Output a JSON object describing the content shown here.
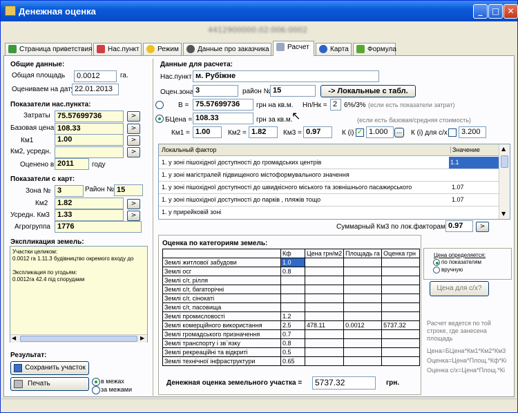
{
  "window": {
    "title": "Денежная оценка",
    "subtitle": "4412900000:02:006:0002"
  },
  "tabs": [
    "Страница приветствия",
    "Нас.пункт",
    "Режим",
    "Данные про заказчика",
    "Расчет",
    "Карта",
    "Формула"
  ],
  "left": {
    "general_header": "Общие данные:",
    "area_label": "Общая площадь",
    "area_value": "0.0012",
    "area_unit": "га.",
    "date_label": "Оцениваем на дату",
    "date_value": "22.01.2013",
    "settlement_header": "Показатели нас.пункта:",
    "costs_label": "Затраты",
    "costs_value": "75.57699736",
    "base_price_label": "Базовая цена",
    "base_price_value": "108.33",
    "km1_label": "Км1",
    "km1_value": "1.00",
    "km2avg_label": "Км2, усредн.",
    "km2avg_value": "",
    "valued_in_label": "Оценено в",
    "valued_in_value": "2011",
    "valued_in_unit": "году",
    "map_header": "Показатели с карт:",
    "zone_label": "Зона №",
    "zone_value": "3",
    "district_label": "Район №",
    "district_value": "15",
    "km2_label": "Км2",
    "km2_value": "1.82",
    "km3avg_label": "Усредн. Км3",
    "km3avg_value": "1.33",
    "agrogroup_label": "Агрогруппа",
    "agrogroup_value": "1776",
    "explication_header": "Экспликация земель:",
    "memo_lines": [
      "Участки целиком:",
      "0.0012 га   1.11.3 будівництво окремого входу до",
      "",
      "Экспликация по угодьям:",
      "0.0012га    42.4 під спорудами"
    ],
    "result_header": "Результат:",
    "save_button": "Сохранить участок",
    "print_button": "Печать",
    "radio_within": "в межах",
    "radio_outside": "за межами"
  },
  "right": {
    "calc_header": "Данные для расчета:",
    "settlement_label": "Нас.пункт",
    "settlement_value": "м. Рубіжне",
    "zone_label": "Оцен.зона",
    "zone_value": "3",
    "district_label": "район №",
    "district_value": "15",
    "local_button": "-> Локальные с табл.",
    "b_label": "В =",
    "b_value": "75.57699736",
    "b_unit": "грн на кв.м.",
    "nn_label": "Нп/Нк =",
    "nn_value": "2",
    "nn_unit": "6%/3%",
    "nn_hint": "(если есть показатели затрат)",
    "bprice_label": "БЦена =",
    "bprice_value": "108.33",
    "bprice_unit": "грн за кв.м.",
    "bprice_hint": "(если есть базовая/средняя стоимость)",
    "km1_label": "Км1 =",
    "km1_value": "1.00",
    "km2_label": "Км2 =",
    "km2_value": "1.82",
    "km3_label": "Км3 =",
    "km3_value": "0.97",
    "ki_label": "К (і)",
    "ki_value": "1.000",
    "ki_btn": "...",
    "kis_label": "К (і) для с/х",
    "kis_value": "3.200",
    "factor_col": "Локальный фактор",
    "value_col": "Значение",
    "factors": [
      {
        "name": "1. у зоні пішохідної доступності до громадських центрів",
        "value": "1.1"
      },
      {
        "name": "1. у зоні магістралей підвищеного містоформувального значення",
        "value": ""
      },
      {
        "name": "1. у зоні пішохідної доступності до швидкісного міського та зовнішнього пасажирського",
        "value": "1.07"
      },
      {
        "name": "1. у зоні пішохідної доступності до парків , пляжів тощо",
        "value": "1.07"
      },
      {
        "name": "1. у прирейковій зоні",
        "value": ""
      }
    ],
    "total_km3_label": "Суммарный Км3 по лок.факторам=",
    "total_km3_value": "0.97",
    "categories_header": "Оценка по категориям земель:",
    "cat_cols": [
      "",
      "Кф",
      "Цена грн/м2",
      "Площадь га",
      "Оценка грн"
    ],
    "categories": [
      {
        "name": "Землі житлової забудови",
        "kf": "1.0",
        "price": "",
        "area": "",
        "value": ""
      },
      {
        "name": "Землі осг",
        "kf": "0.8",
        "price": "",
        "area": "",
        "value": ""
      },
      {
        "name": "Землі с/г, рілля",
        "kf": "",
        "price": "",
        "area": "",
        "value": ""
      },
      {
        "name": "Землі с/г, багаторічні",
        "kf": "",
        "price": "",
        "area": "",
        "value": ""
      },
      {
        "name": "Землі с/г, сінокаті",
        "kf": "",
        "price": "",
        "area": "",
        "value": ""
      },
      {
        "name": "Землі с/г, пасовища",
        "kf": "",
        "price": "",
        "area": "",
        "value": ""
      },
      {
        "name": "Землі промисловості",
        "kf": "1.2",
        "price": "",
        "area": "",
        "value": ""
      },
      {
        "name": "Землі комерційного використання",
        "kf": "2.5",
        "price": "478.11",
        "area": "0.0012",
        "value": "5737.32"
      },
      {
        "name": "Землі громадського призначення",
        "kf": "0.7",
        "price": "",
        "area": "",
        "value": ""
      },
      {
        "name": "Землі транспорту і зв`язку",
        "kf": "0.8",
        "price": "",
        "area": "",
        "value": ""
      },
      {
        "name": "Землі рекреаційні та відкриті",
        "kf": "0.5",
        "price": "",
        "area": "",
        "value": ""
      },
      {
        "name": "Землі технічної інфраструктури",
        "kf": "0.65",
        "price": "",
        "area": "",
        "value": ""
      }
    ],
    "price_group_title": "Цена определяется:",
    "radio_indicators": "по показателям",
    "radio_manual": "вручную",
    "price_ag_button": "Цена для с/х?",
    "note": "Расчет ведется по той строке, где занесена площадь",
    "formula1": "Цена=БЦена*Км1*Км2*Км3",
    "formula2": "Оценка=Цена*Площ.*Кф*Кі",
    "formula3": "Оценка с/х=Цена*Площ.*Кі",
    "total_label": "Денежная оценка земельного участка =",
    "total_value": "5737.32",
    "total_unit": "грн."
  },
  "colors": {
    "title_bar": "#0a5bd9",
    "highlight": "#316ac5",
    "readonly": "#fcfcd8"
  }
}
